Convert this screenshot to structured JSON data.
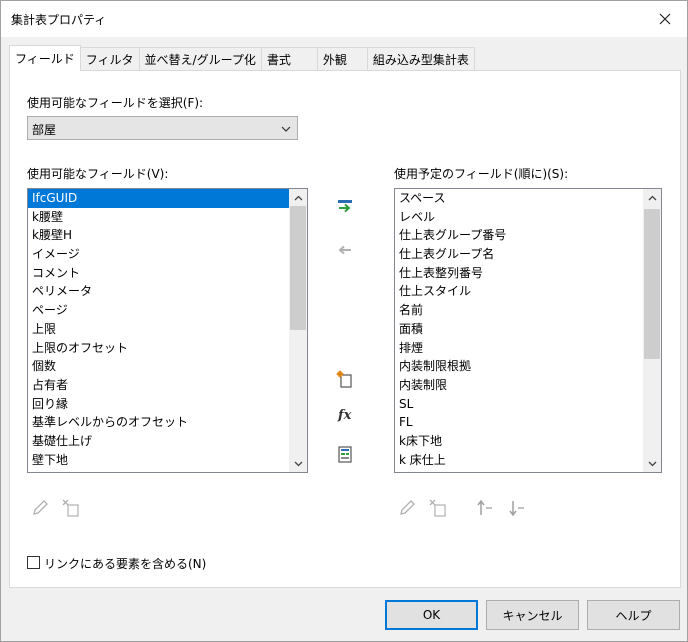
{
  "window": {
    "title": "集計表プロパティ"
  },
  "tabs": [
    {
      "label": "フィールド"
    },
    {
      "label": "フィルタ"
    },
    {
      "label": "並べ替え/グループ化"
    },
    {
      "label": "書式"
    },
    {
      "label": "外観"
    },
    {
      "label": "組み込み型集計表"
    }
  ],
  "fields_panel": {
    "select_label": "使用可能なフィールドを選択(F):",
    "select_value": "部屋",
    "available_label": "使用可能なフィールド(V):",
    "available_items": [
      "IfcGUID",
      "k腰壁",
      "k腰壁H",
      "イメージ",
      "コメント",
      "ペリメータ",
      "ページ",
      "上限",
      "上限のオフセット",
      "個数",
      "占有者",
      "回り縁",
      "基準レベルからのオフセット",
      "基礎仕上げ",
      "壁下地"
    ],
    "scheduled_label": "使用予定のフィールド(順に)(S):",
    "scheduled_items": [
      "スペース",
      "レベル",
      "仕上表グループ番号",
      "仕上表グループ名",
      "仕上表整列番号",
      "仕上スタイル",
      "名前",
      "面積",
      "排煙",
      "内装制限根拠",
      "内装制限",
      "SL",
      "FL",
      "k床下地",
      "k 床仕上"
    ],
    "include_links_label": "リンクにある要素を含める(N)"
  },
  "icons": {
    "add": "add-field-icon",
    "remove": "remove-field-icon",
    "new_parameter": "new-parameter-icon",
    "calculated": "fx-icon",
    "combine": "combine-parameters-icon",
    "edit": "pencil-icon",
    "delete": "delete-icon",
    "move_up": "move-up-icon",
    "move_down": "move-down-icon"
  },
  "footer": {
    "ok": "OK",
    "cancel": "キャンセル",
    "help": "ヘルプ"
  },
  "colors": {
    "selection": "#0078d7",
    "add_arrow": "#2e9e3e",
    "add_bar": "#2a6db5"
  }
}
